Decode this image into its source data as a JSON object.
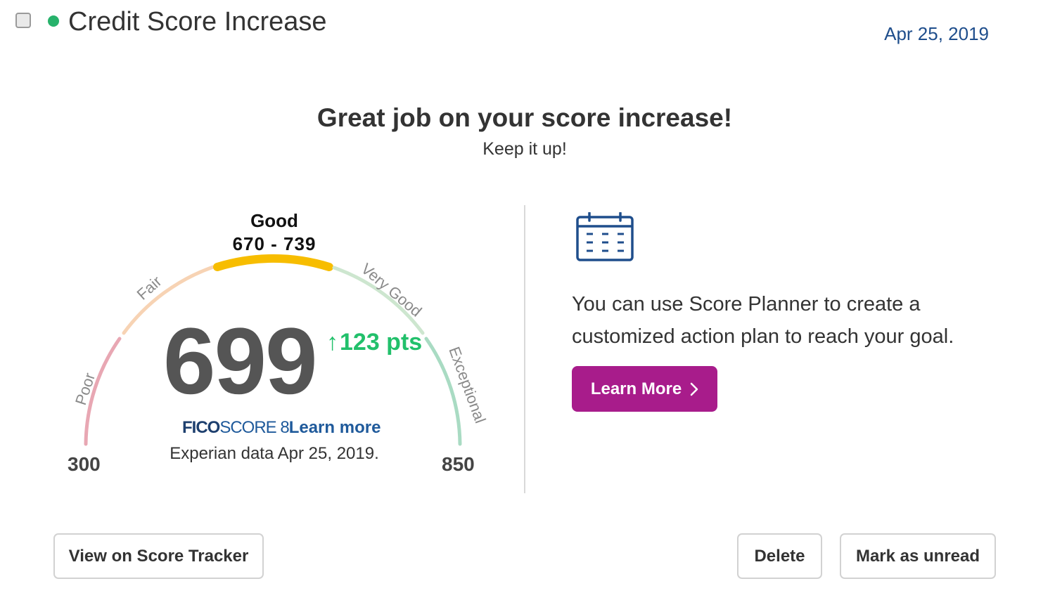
{
  "alert": {
    "title": "Credit Score Increase",
    "date": "Apr 25, 2019",
    "status_color": "#27b26b"
  },
  "message": {
    "headline": "Great job on your score increase!",
    "subline": "Keep it up!"
  },
  "gauge": {
    "current_range": {
      "name": "Good",
      "values": "670 - 739"
    },
    "segments": [
      {
        "label": "Poor",
        "color": "#e8a7b3"
      },
      {
        "label": "Fair",
        "color": "#f7d3b4"
      },
      {
        "label": "Good",
        "color": "#f7bd00"
      },
      {
        "label": "Very Good",
        "color": "#cde6cf"
      },
      {
        "label": "Exceptional",
        "color": "#a9dbc3"
      }
    ],
    "min": "300",
    "max": "850",
    "score": "699",
    "score_value": 699,
    "change": "123 pts",
    "change_arrow": "↑",
    "score_brand": "FICO",
    "score_model": "SCORE 8",
    "score_link": "Learn more",
    "data_source": "Experian data Apr 25, 2019."
  },
  "planner": {
    "icon": "calendar-icon",
    "text": "You can use Score Planner to create a customized action plan to reach your goal.",
    "button_label": "Learn More",
    "button_color": "#a81c8b"
  },
  "actions": {
    "tracker_label": "View on Score Tracker",
    "delete_label": "Delete",
    "unread_label": "Mark as unread"
  }
}
